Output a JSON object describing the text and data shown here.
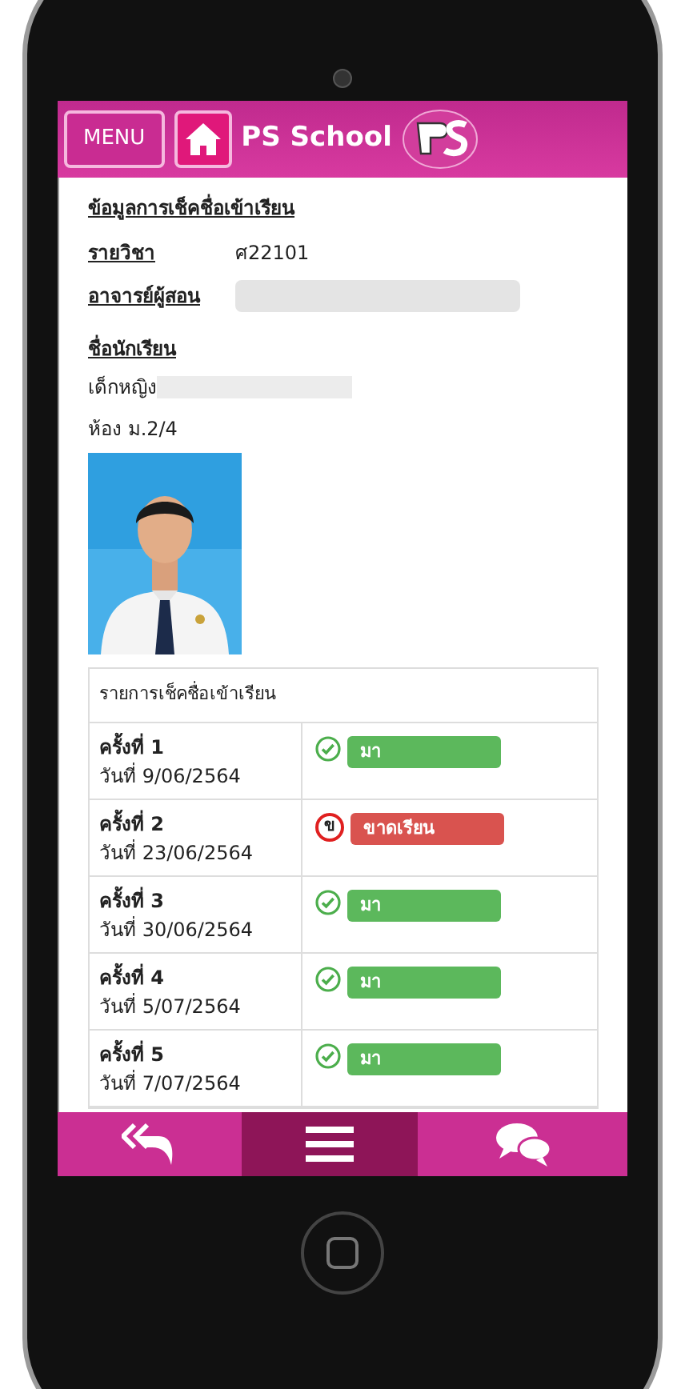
{
  "header": {
    "menu_button": "MENU",
    "title": "PS School"
  },
  "info": {
    "heading": "ข้อมูลการเช็คชื่อเข้าเรียน",
    "subject_label": "รายวิชา",
    "subject_value": "ศ22101",
    "teacher_label": "อาจารย์ผู้สอน",
    "student_label": "ชื่อนักเรียน",
    "student_name": "เด็กหญิง",
    "room": "ห้อง ม.2/4"
  },
  "attendance": {
    "title": "รายการเช็คชื่อเข้าเรียน",
    "rows": [
      {
        "session": "ครั้งที่ 1",
        "date": "วันที่ 9/06/2564",
        "kind": "present",
        "status": "มา"
      },
      {
        "session": "ครั้งที่ 2",
        "date": "วันที่ 23/06/2564",
        "kind": "absent",
        "icon_text": "ข",
        "status": "ขาดเรียน"
      },
      {
        "session": "ครั้งที่ 3",
        "date": "วันที่ 30/06/2564",
        "kind": "present",
        "status": "มา"
      },
      {
        "session": "ครั้งที่ 4",
        "date": "วันที่ 5/07/2564",
        "kind": "present",
        "status": "มา"
      },
      {
        "session": "ครั้งที่ 5",
        "date": "วันที่ 7/07/2564",
        "kind": "present",
        "status": "มา"
      }
    ]
  }
}
